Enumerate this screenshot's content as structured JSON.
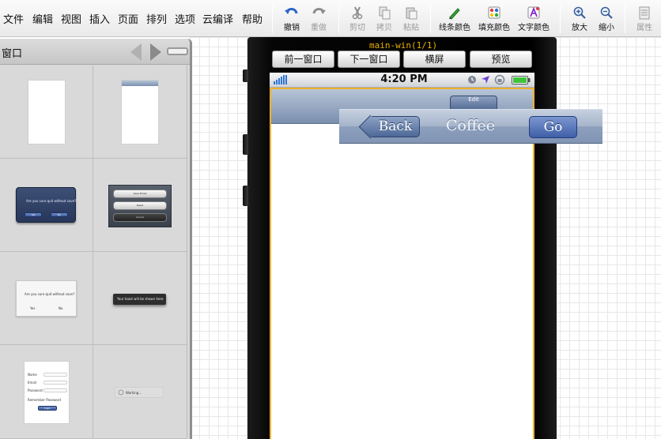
{
  "menu": [
    "文件",
    "编辑",
    "视图",
    "插入",
    "页面",
    "排列",
    "选项",
    "云编译",
    "帮助"
  ],
  "toolbar": {
    "undo": "撤销",
    "redo": "重做",
    "cut": "剪切",
    "copy": "拷贝",
    "paste": "粘贴",
    "line_color": "线条颜色",
    "fill_color": "填充颜色",
    "text_color": "文字颜色",
    "zoom_in": "放大",
    "zoom_out": "缩小",
    "properties": "属性"
  },
  "left_panel": {
    "title": "窗口",
    "thumb_texts": {
      "alert_dark_message": "Are you sure quit without save?",
      "alert_dark_yes": "Yes",
      "alert_dark_no": "No",
      "sheet_btn1": "Save Email",
      "sheet_btn2": "Reset",
      "sheet_btn3": "Cancel",
      "alert_light_message": "Are you sure quit without save?",
      "alert_light_yes": "Yes",
      "alert_light_no": "No",
      "toast": "Your toast will be shown here",
      "form_name": "Name",
      "form_email": "Email",
      "form_password": "Password",
      "form_remember": "Remember Password",
      "form_login": "Login",
      "progress": "Working..."
    }
  },
  "simulator": {
    "label": "main-win(1/1)",
    "prev_window": "前一窗口",
    "next_window": "下一窗口",
    "landscape": "横屏",
    "preview": "预览",
    "status_time": "4:20 PM",
    "ghost_button": "Edit"
  },
  "drag_navbar": {
    "back": "Back",
    "title": "Coffee",
    "go": "Go"
  },
  "colors": {
    "selection": "#f0b02a",
    "navbar": "#8194b4",
    "signal": "#2f75d6"
  }
}
